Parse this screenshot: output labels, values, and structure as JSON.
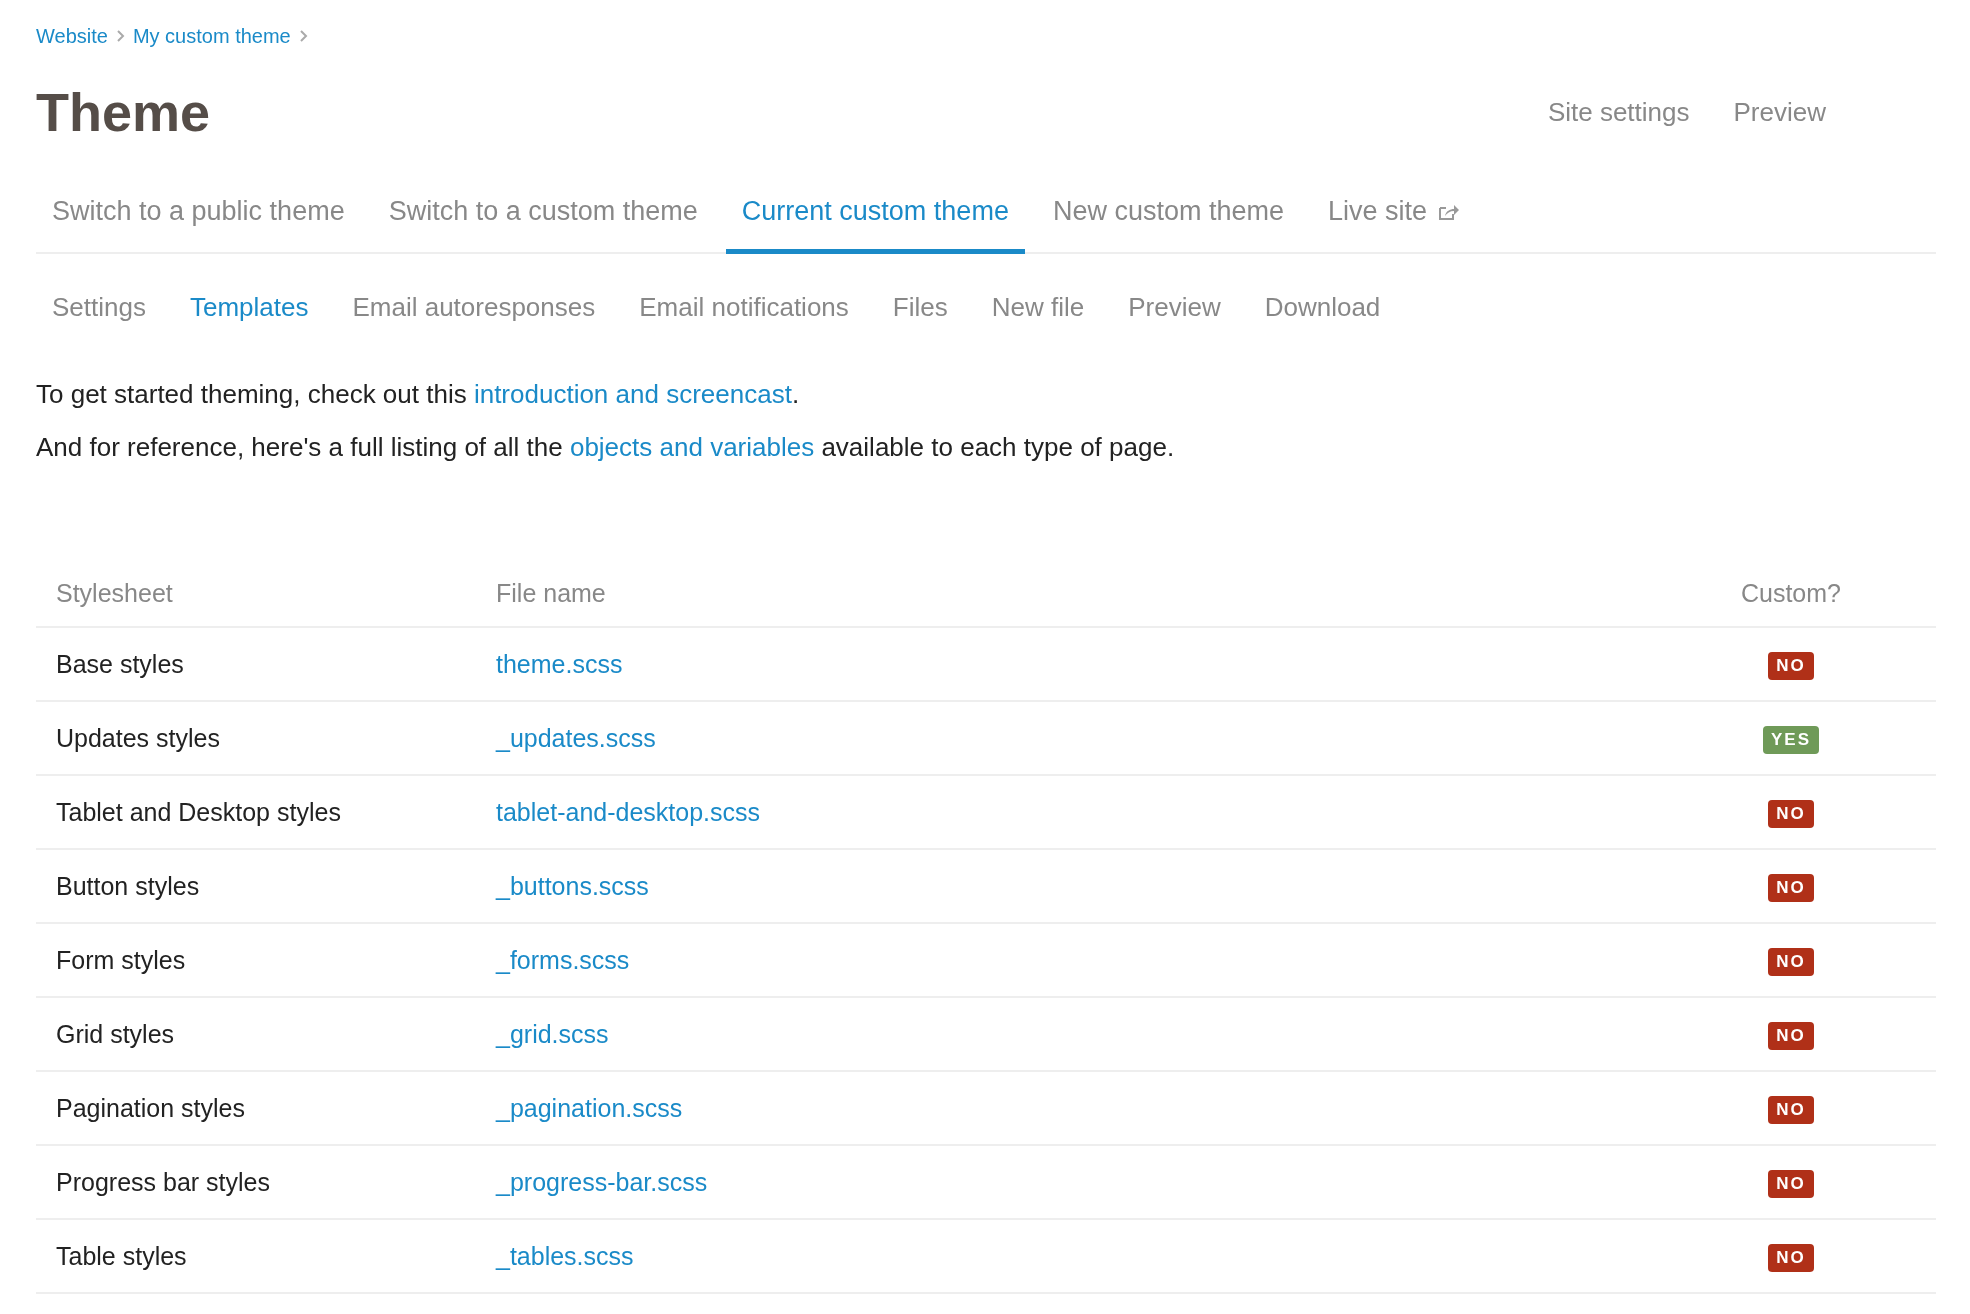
{
  "breadcrumb": [
    {
      "label": "Website"
    },
    {
      "label": "My custom theme"
    }
  ],
  "title": "Theme",
  "header_links": [
    {
      "label": "Site settings"
    },
    {
      "label": "Preview"
    }
  ],
  "tabs": [
    {
      "label": "Switch to a public theme",
      "selected": false,
      "external": false
    },
    {
      "label": "Switch to a custom theme",
      "selected": false,
      "external": false
    },
    {
      "label": "Current custom theme",
      "selected": true,
      "external": false
    },
    {
      "label": "New custom theme",
      "selected": false,
      "external": false
    },
    {
      "label": "Live site",
      "selected": false,
      "external": true
    }
  ],
  "subtabs": [
    {
      "label": "Settings",
      "selected": false
    },
    {
      "label": "Templates",
      "selected": true
    },
    {
      "label": "Email autoresponses",
      "selected": false
    },
    {
      "label": "Email notifications",
      "selected": false
    },
    {
      "label": "Files",
      "selected": false
    },
    {
      "label": "New file",
      "selected": false
    },
    {
      "label": "Preview",
      "selected": false
    },
    {
      "label": "Download",
      "selected": false
    }
  ],
  "intro": [
    {
      "before": "To get started theming, check out this ",
      "link": "introduction and screencast",
      "after": "."
    },
    {
      "before": "And for reference, here's a full listing of all the ",
      "link": "objects and variables",
      "after": " available to each type of page."
    }
  ],
  "table": {
    "columns": [
      "Stylesheet",
      "File name",
      "Custom?"
    ],
    "rows": [
      {
        "stylesheet": "Base styles",
        "file": "theme.scss",
        "badge": "NO",
        "custom": false
      },
      {
        "stylesheet": "Updates styles",
        "file": "_updates.scss",
        "badge": "YES",
        "custom": true
      },
      {
        "stylesheet": "Tablet and Desktop styles",
        "file": "tablet-and-desktop.scss",
        "badge": "NO",
        "custom": false
      },
      {
        "stylesheet": "Button styles",
        "file": "_buttons.scss",
        "badge": "NO",
        "custom": false
      },
      {
        "stylesheet": "Form styles",
        "file": "_forms.scss",
        "badge": "NO",
        "custom": false
      },
      {
        "stylesheet": "Grid styles",
        "file": "_grid.scss",
        "badge": "NO",
        "custom": false
      },
      {
        "stylesheet": "Pagination styles",
        "file": "_pagination.scss",
        "badge": "NO",
        "custom": false
      },
      {
        "stylesheet": "Progress bar styles",
        "file": "_progress-bar.scss",
        "badge": "NO",
        "custom": false
      },
      {
        "stylesheet": "Table styles",
        "file": "_tables.scss",
        "badge": "NO",
        "custom": false
      }
    ]
  }
}
